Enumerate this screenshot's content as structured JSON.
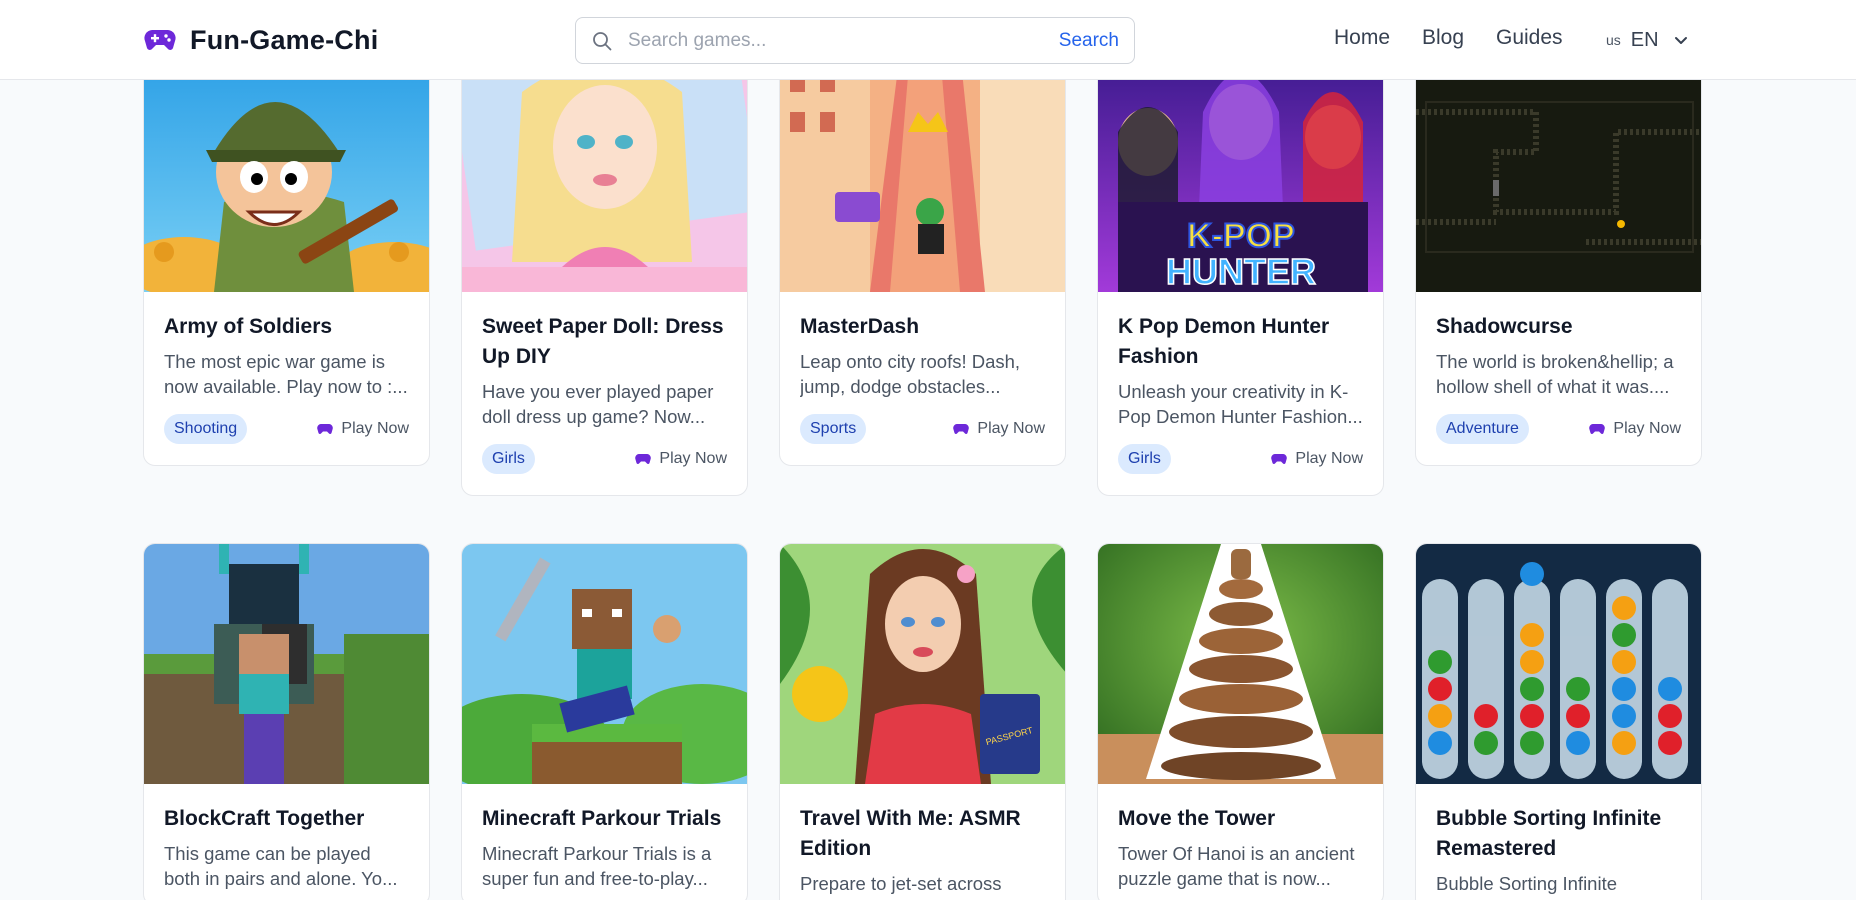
{
  "header": {
    "logo_text": "Fun-Game-Chi",
    "search_placeholder": "Search games...",
    "search_button": "Search",
    "nav": [
      "Home",
      "Blog",
      "Guides"
    ],
    "lang_flag": "us",
    "lang_code": "EN"
  },
  "play_label": "Play Now",
  "cards": [
    {
      "title": "Army of Soldiers",
      "desc": "The most epic war game is now available. Play now to :...",
      "tag": "Shooting",
      "thumb": "soldier"
    },
    {
      "title": "Sweet Paper Doll: Dress Up DIY",
      "desc": "Have you ever played paper doll dress up game? Now...",
      "tag": "Girls",
      "thumb": "paper-doll"
    },
    {
      "title": "MasterDash",
      "desc": "Leap onto city roofs! Dash, jump, dodge obstacles...",
      "tag": "Sports",
      "thumb": "rooftop-runner"
    },
    {
      "title": "K Pop Demon Hunter Fashion",
      "desc": "Unleash your creativity in K-Pop Demon Hunter Fashion...",
      "tag": "Girls",
      "thumb": "kpop-hunter",
      "thumb_text": "K-POP HUNTER"
    },
    {
      "title": "Shadowcurse",
      "desc": "The world is broken&hellip; a hollow shell of what it was....",
      "tag": "Adventure",
      "thumb": "dark-dungeon"
    },
    {
      "title": "BlockCraft Together",
      "desc": "This game can be played both in pairs and alone. Yo...",
      "tag": "",
      "thumb": "blockcraft"
    },
    {
      "title": "Minecraft Parkour Trials",
      "desc": "Minecraft Parkour Trials is a super fun and free-to-play...",
      "tag": "",
      "thumb": "parkour"
    },
    {
      "title": "Travel With Me: ASMR Edition",
      "desc": "Prepare to jet-set across the...",
      "tag": "",
      "thumb": "travel-girl",
      "thumb_text": "PASSPORT"
    },
    {
      "title": "Move the Tower",
      "desc": "Tower Of Hanoi is an ancient puzzle game that is now...",
      "tag": "",
      "thumb": "tower"
    },
    {
      "title": "Bubble Sorting Infinite Remastered",
      "desc": "Bubble Sorting Infinite",
      "tag": "",
      "thumb": "bubble-tubes"
    }
  ],
  "colors": {
    "accent": "#2563eb",
    "tag_bg": "#dbeafe",
    "tag_text": "#1e40af",
    "gamepad": "#6d28d9"
  }
}
